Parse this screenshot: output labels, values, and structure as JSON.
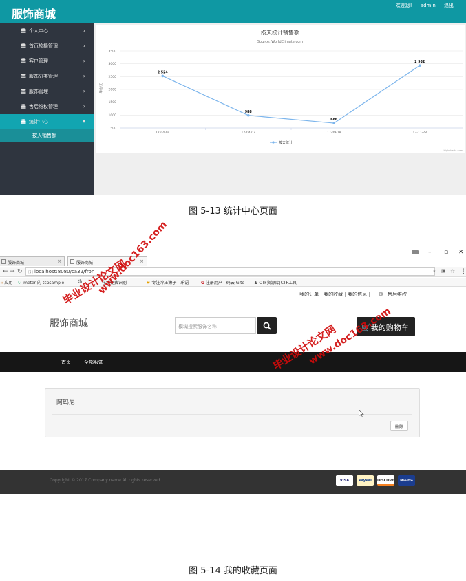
{
  "admin": {
    "logo": "服饰商城",
    "toplinks": [
      "欢迎您!",
      "admin",
      "退出"
    ],
    "sidebar": [
      {
        "label": "个人中心",
        "icon": "database-icon"
      },
      {
        "label": "首页轮播管理",
        "icon": "database-icon"
      },
      {
        "label": "客户管理",
        "icon": "database-icon"
      },
      {
        "label": "服饰分类管理",
        "icon": "database-icon"
      },
      {
        "label": "服饰管理",
        "icon": "database-icon"
      },
      {
        "label": "售后维权管理",
        "icon": "database-icon"
      },
      {
        "label": "统计中心",
        "icon": "database-icon",
        "active": true
      }
    ],
    "sidebar_sub": "按天销售额"
  },
  "chart_data": {
    "type": "line",
    "title": "按天统计销售额",
    "subtitle": "Source: WorldClimate.com",
    "ylabel": "单位/元",
    "xlabel": "",
    "categories": [
      "17-04-04",
      "17-04-07",
      "17-09-18",
      "17-11-28"
    ],
    "series": [
      {
        "name": "按天统计",
        "values": [
          2524,
          988,
          686,
          2932
        ]
      }
    ],
    "data_labels": [
      "2 524",
      "988",
      "686",
      "2 932"
    ],
    "yticks": [
      "3500",
      "3000",
      "2500",
      "2000",
      "1500",
      "1000",
      "500"
    ],
    "ylim": [
      500,
      3500
    ],
    "credits": "Highcharts.com",
    "legend": "bottom-center",
    "grid": true,
    "color": "#7cb5ec"
  },
  "caption1": "图 5-13 统计中心页面",
  "browser": {
    "tabs": [
      "服饰商城",
      "服饰商城"
    ],
    "url": "localhost:8080/ca32/fron",
    "bookmarks": [
      "应用",
      "jmeter 的 tcpsample",
      "th",
      "在线免费识别",
      "专注冷压獭子 - 乐语",
      "注册用户 - 码云 Gite",
      "CTF资源库|CTF工具"
    ]
  },
  "site": {
    "toplinks": [
      "我的订单",
      "我的收藏",
      "我的信息",
      "",
      "售后维权"
    ],
    "logo": "服饰商城",
    "search_placeholder": "模糊搜索服饰名称",
    "cart_label": "我的购物车",
    "nav": [
      "首页",
      "全部服饰"
    ],
    "favorite_item": "阿玛尼",
    "delete_label": "删除",
    "copyright": "Copyright © 2017 Company name All rights reserved",
    "payments": [
      "VISA",
      "PayPal",
      "DISCOVER",
      "Maestro"
    ]
  },
  "caption2": "图 5-14 我的收藏页面",
  "watermarks": {
    "cn": "毕业设计论文网",
    "url": "www.doc163.com"
  }
}
